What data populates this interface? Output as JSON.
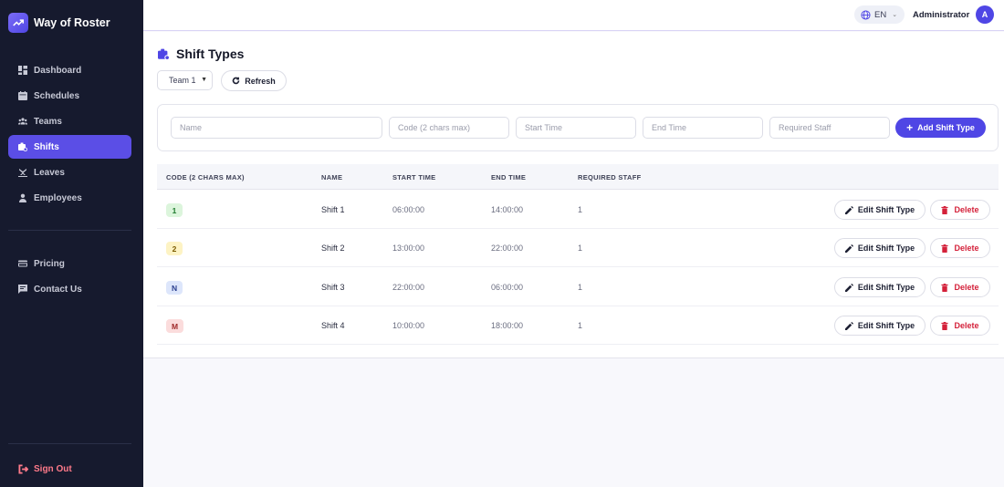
{
  "app": {
    "name": "Way of Roster"
  },
  "sidebar": {
    "items": [
      {
        "label": "Dashboard",
        "icon": "dashboard-icon",
        "active": false
      },
      {
        "label": "Schedules",
        "icon": "calendar-icon",
        "active": false
      },
      {
        "label": "Teams",
        "icon": "teams-icon",
        "active": false
      },
      {
        "label": "Shifts",
        "icon": "shifts-icon",
        "active": true
      },
      {
        "label": "Leaves",
        "icon": "leaves-icon",
        "active": false
      },
      {
        "label": "Employees",
        "icon": "person-icon",
        "active": false
      }
    ],
    "secondary": [
      {
        "label": "Pricing",
        "icon": "card-icon"
      },
      {
        "label": "Contact Us",
        "icon": "chat-icon"
      }
    ],
    "signout_label": "Sign Out"
  },
  "topbar": {
    "language": "EN",
    "user_name": "Administrator",
    "avatar_initial": "A"
  },
  "page": {
    "title": "Shift Types",
    "team_select_value": "Team 1",
    "refresh_label": "Refresh"
  },
  "form": {
    "name_placeholder": "Name",
    "code_placeholder": "Code (2 chars max)",
    "start_placeholder": "Start Time",
    "end_placeholder": "End Time",
    "staff_placeholder": "Required Staff",
    "add_label": "Add Shift Type"
  },
  "table": {
    "headers": {
      "code": "CODE (2 CHARS MAX)",
      "name": "NAME",
      "start": "START TIME",
      "end": "END TIME",
      "staff": "REQUIRED STAFF"
    },
    "edit_label": "Edit Shift Type",
    "delete_label": "Delete",
    "rows": [
      {
        "code": "1",
        "name": "Shift 1",
        "start": "06:00:00",
        "end": "14:00:00",
        "staff": "1",
        "badge_bg": "#dcf5dc",
        "badge_fg": "#1f7a2e"
      },
      {
        "code": "2",
        "name": "Shift 2",
        "start": "13:00:00",
        "end": "22:00:00",
        "staff": "1",
        "badge_bg": "#fdf3c4",
        "badge_fg": "#7a5a00"
      },
      {
        "code": "N",
        "name": "Shift 3",
        "start": "22:00:00",
        "end": "06:00:00",
        "staff": "1",
        "badge_bg": "#dde6fb",
        "badge_fg": "#2b3f8f"
      },
      {
        "code": "M",
        "name": "Shift 4",
        "start": "10:00:00",
        "end": "18:00:00",
        "staff": "1",
        "badge_bg": "#fbdcdc",
        "badge_fg": "#a02a2a"
      }
    ]
  },
  "colors": {
    "accent": "#4f46e5",
    "sidebar_bg": "#161a2e",
    "danger": "#d4213a",
    "signout": "#ff7a8a"
  }
}
